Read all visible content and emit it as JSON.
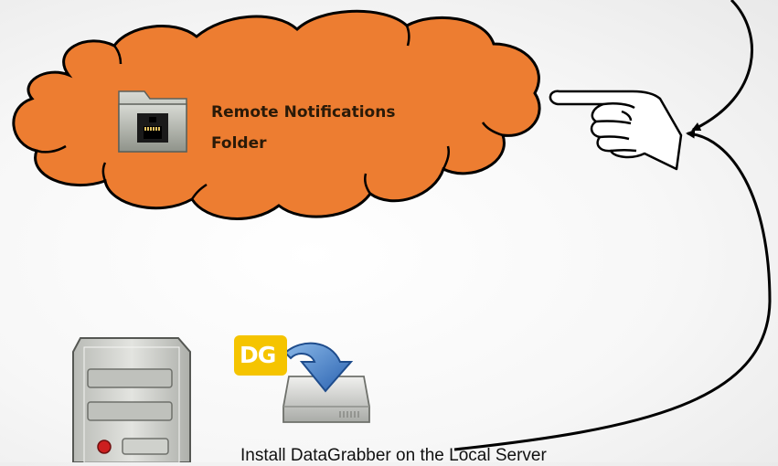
{
  "cloud": {
    "label_line1": "Remote Notifications",
    "label_line2": "Folder",
    "fill_color": "#ED7D31",
    "icon": "network-folder-icon"
  },
  "hand": {
    "icon": "pointing-hand-icon"
  },
  "server": {
    "icon": "server-tower-icon"
  },
  "installer": {
    "badge_text": "DG",
    "badge_color": "#F5C400",
    "icon": "install-drive-icon"
  },
  "caption": "Install DataGrabber on the Local Server"
}
